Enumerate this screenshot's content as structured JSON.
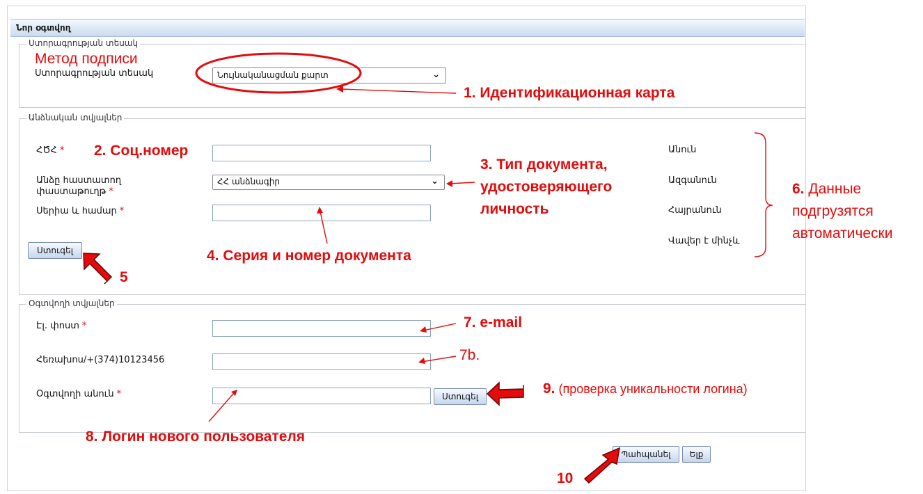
{
  "window": {
    "title": "Նոր օգտվող"
  },
  "signature_section": {
    "legend": "Ստորագրության տեսակ",
    "field_label": "Ստորագրության տեսակ",
    "selected": "Նույնականացման քարտ"
  },
  "personal_section": {
    "legend": "Անձնական տվյալներ",
    "ssn_label": "ՀԾՀ",
    "doc_type_label": "Անձը հաստատող փաստաթուղթ",
    "doc_type_selected": "ՀՀ անձնագիր",
    "serial_label": "Սերիա և համար",
    "check_button": "Ստուգել",
    "auto_fields": [
      "Անուն",
      "Ազգանուն",
      "Հայրանուն",
      "Վավեր է մինչև"
    ],
    "required_mark": "*"
  },
  "user_section": {
    "legend": "Օգտվողի տվյալներ",
    "email_label": "Էլ. փոստ",
    "phone_label": "Հեռախոս/+(374)10123456",
    "username_label": "Օգտվողի անուն",
    "check_button": "Ստուգել"
  },
  "footer": {
    "save_button": "Պահպանել",
    "exit_button": "Ելք"
  },
  "annotations": {
    "signature_method": "Метод подписи",
    "a1": "1. Идентификационная карта",
    "a2": "2. Соц.номер",
    "a3_line1": "3. Тип документа,",
    "a3_line2": "удостоверяющего",
    "a3_line3": "личность",
    "a4": "4. Серия и номер документа",
    "a5": "5",
    "a6_num": "6.",
    "a6_line1": "Данные",
    "a6_line2": "подгрузятся",
    "a6_line3": "автоматически",
    "a7": "7. e-mail",
    "a7b": "7b.",
    "a8": "8. Логин нового пользователя",
    "a9_num": "9.",
    "a9_text": "(проверка уникальности логина)",
    "a10": "10"
  },
  "colors": {
    "annotation": "#e30b0b",
    "title_gradient": "#c9daf0",
    "button_gradient": "#c6d6ee"
  }
}
